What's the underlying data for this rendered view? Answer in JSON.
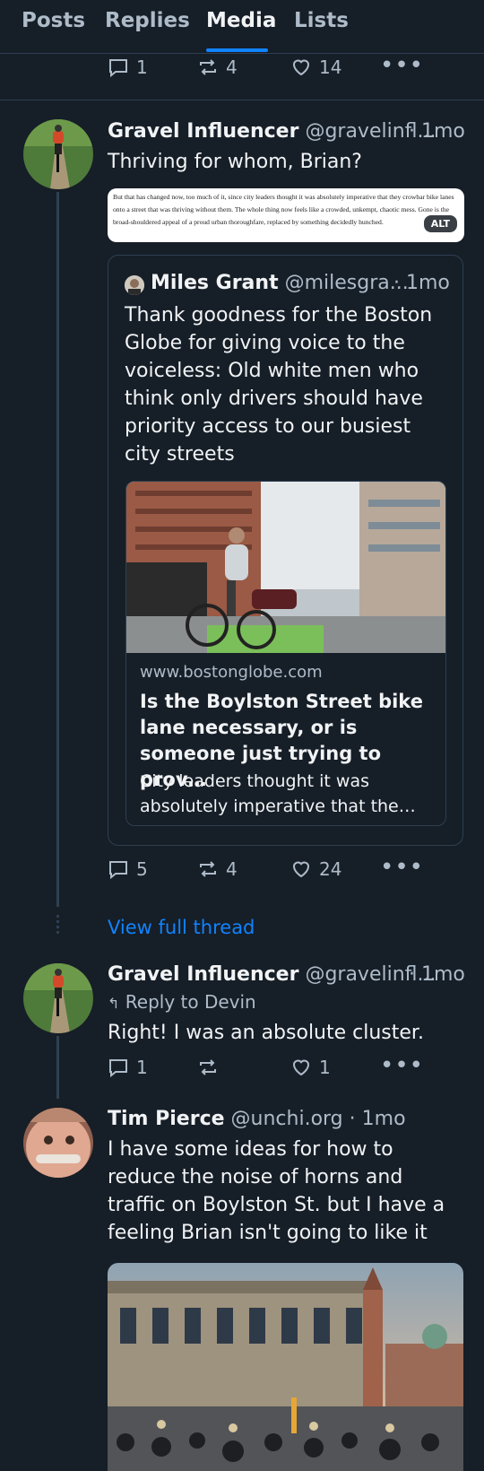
{
  "tabs": [
    "Posts",
    "Replies",
    "Media",
    "Lists"
  ],
  "active_tab": "Media",
  "top_post": {
    "replies": "1",
    "reposts": "4",
    "likes": "14"
  },
  "post1": {
    "author_name": "Gravel Influencer",
    "author_handle": "@gravelinfl...",
    "time": "· 1mo",
    "text": "Thriving for whom, Brian?",
    "quoted_image_text": "But that has changed now, too much of it, since city leaders thought it was absolutely imperative that they crowbar bike lanes onto a street that was thriving without them. The whole thing now feels like a crowded, unkempt, chaotic mess. Gone is the broad-shouldered appeal of a proud urban thoroughfare, replaced by something decidedly hunched.",
    "alt_badge": "ALT",
    "quote": {
      "author_name": "Miles Grant",
      "author_handle": "@milesgra...",
      "time": "· 1mo",
      "text": "Thank goodness for the Boston Globe for giving voice to the voiceless: Old white men who think only drivers should have priority access to our busiest city streets",
      "link": {
        "domain": "www.bostonglobe.com",
        "title": "Is the Boylston Street bike lane necessary, or is someone just trying to prov…",
        "description": "City leaders thought it was absolutely imperative that the…"
      }
    },
    "replies": "5",
    "reposts": "4",
    "likes": "24"
  },
  "view_full_thread": "View full thread",
  "post2": {
    "author_name": "Gravel Influencer",
    "author_handle": "@gravelinfl...",
    "time": "· 1mo",
    "reply_to": "Reply to Devin",
    "text": "Right! I was an absolute cluster.",
    "replies": "1",
    "reposts": "",
    "likes": "1"
  },
  "post3": {
    "author_name": "Tim Pierce",
    "author_handle": "@unchi.org",
    "time": "· 1mo",
    "text": "I have some ideas for how to reduce the noise of horns and traffic on Boylston St. but I have a feeling Brian isn't going to like it"
  },
  "colors": {
    "background": "#161e27",
    "accent": "#1083fe",
    "muted": "#aebbc9",
    "border": "#2e4052"
  }
}
